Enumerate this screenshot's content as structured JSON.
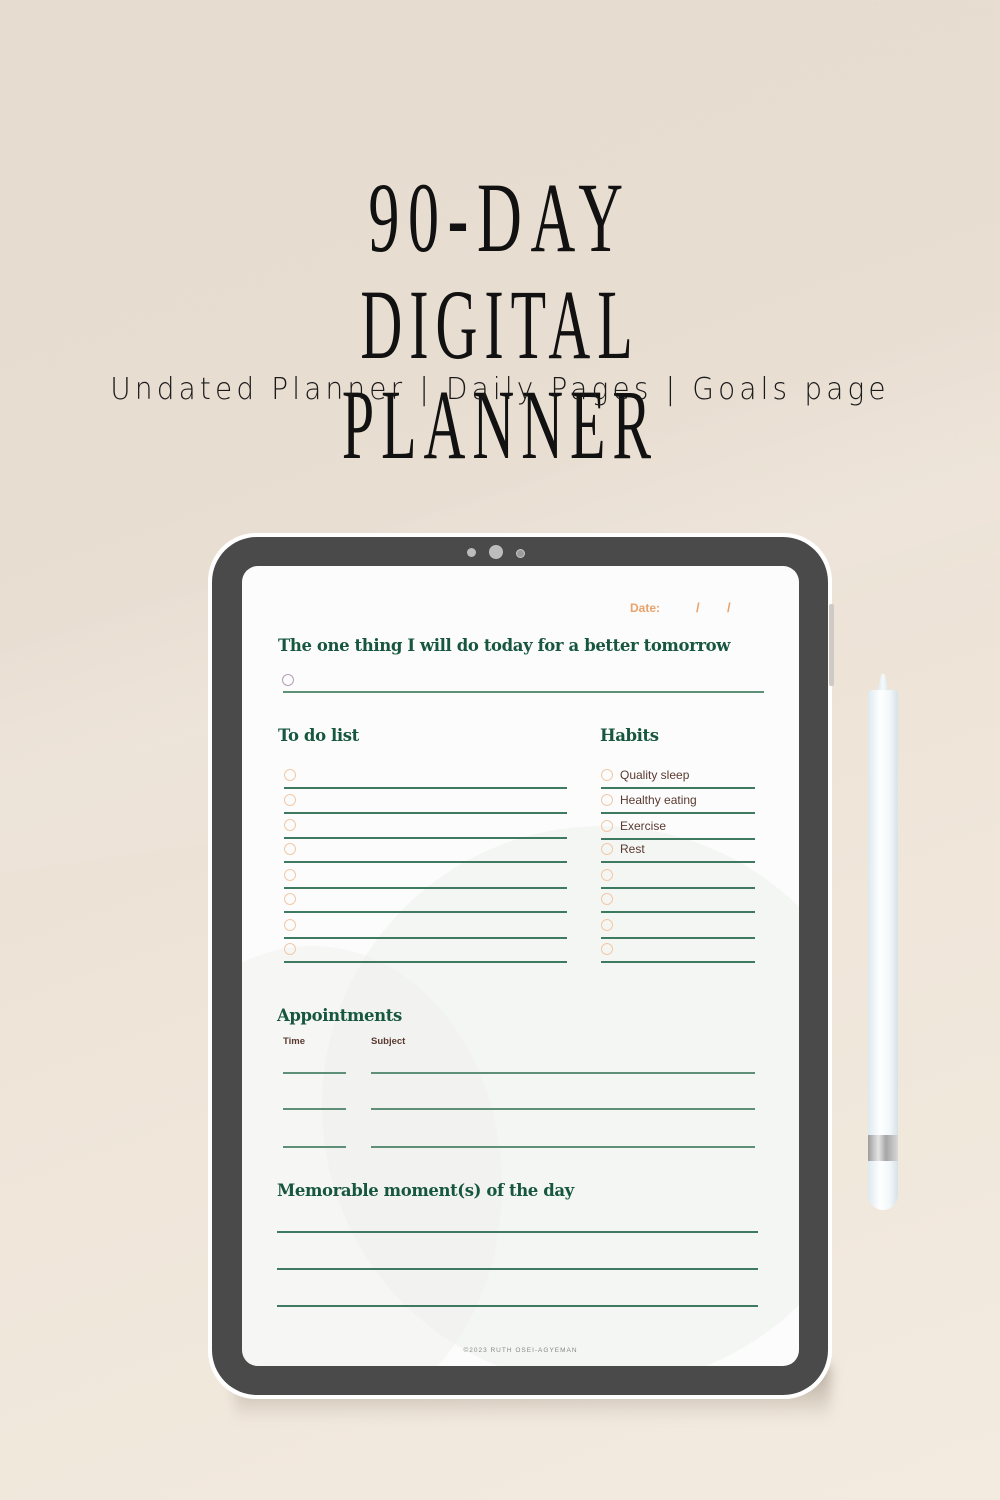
{
  "header": {
    "title_line1": "90-DAY",
    "title_line2": "DIGITAL PLANNER",
    "subtitle": "Undated Planner | Daily Pages | Goals page"
  },
  "planner": {
    "date_label": "Date:",
    "date_separator": "/",
    "one_thing": {
      "heading": "The one thing I will do today for a better tomorrow",
      "value": ""
    },
    "todo": {
      "heading": "To do list",
      "items": [
        "",
        "",
        "",
        "",
        "",
        "",
        "",
        ""
      ]
    },
    "habits": {
      "heading": "Habits",
      "items": [
        "Quality sleep",
        "Healthy eating",
        "Exercise",
        "Rest",
        "",
        "",
        "",
        ""
      ]
    },
    "appointments": {
      "heading": "Appointments",
      "columns": [
        "Time",
        "Subject"
      ],
      "rows": [
        {
          "time": "",
          "subject": ""
        },
        {
          "time": "",
          "subject": ""
        },
        {
          "time": "",
          "subject": ""
        }
      ]
    },
    "memorable": {
      "heading": "Memorable moment(s) of the day",
      "lines": [
        "",
        "",
        ""
      ]
    },
    "footer": "©2023 RUTH OSEI-AGYEMAN"
  },
  "colors": {
    "heading_green": "#17573f",
    "line_green": "#3d7a60",
    "date_orange": "#e8a26a",
    "checkbox_peach": "#f2c9a6",
    "label_brown": "#5a3a30",
    "bezel": "#4b4a4a",
    "background": "#e8ddd1"
  }
}
